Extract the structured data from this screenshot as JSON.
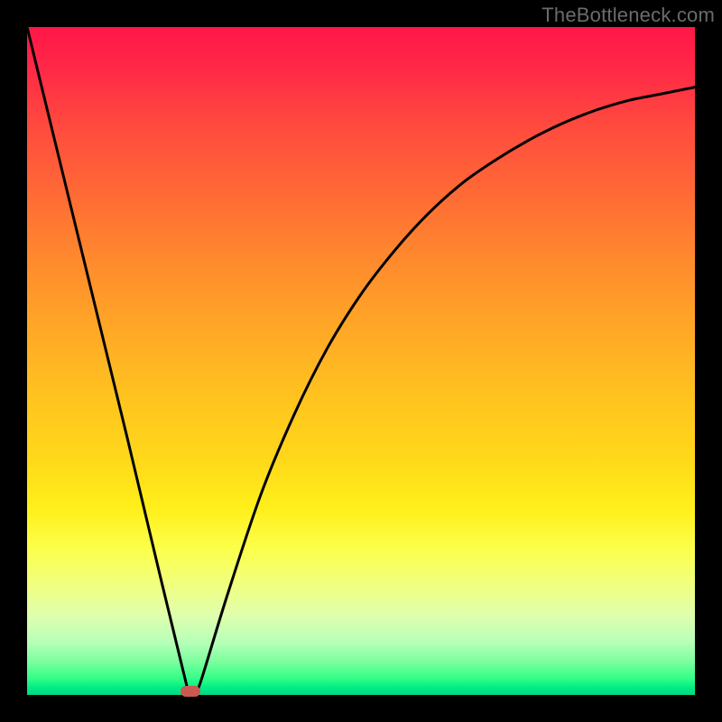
{
  "watermark": "TheBottleneck.com",
  "colors": {
    "frame": "#000000",
    "curve": "#000000",
    "marker": "#c85a52"
  },
  "chart_data": {
    "type": "line",
    "title": "",
    "xlabel": "",
    "ylabel": "",
    "xlim": [
      0,
      100
    ],
    "ylim": [
      0,
      100
    ],
    "grid": false,
    "legend": false,
    "series": [
      {
        "name": "bottleneck-curve",
        "x": [
          0,
          5,
          10,
          15,
          20,
          24,
          25,
          26,
          30,
          35,
          40,
          45,
          50,
          55,
          60,
          65,
          70,
          75,
          80,
          85,
          90,
          95,
          100
        ],
        "y": [
          100,
          79.5,
          59,
          38.5,
          17.5,
          1,
          0,
          2,
          15,
          30,
          42,
          52,
          60,
          66.5,
          72,
          76.5,
          80,
          83,
          85.5,
          87.5,
          89,
          90,
          91
        ]
      }
    ],
    "marker": {
      "x": 24.5,
      "y": 0.5
    }
  }
}
